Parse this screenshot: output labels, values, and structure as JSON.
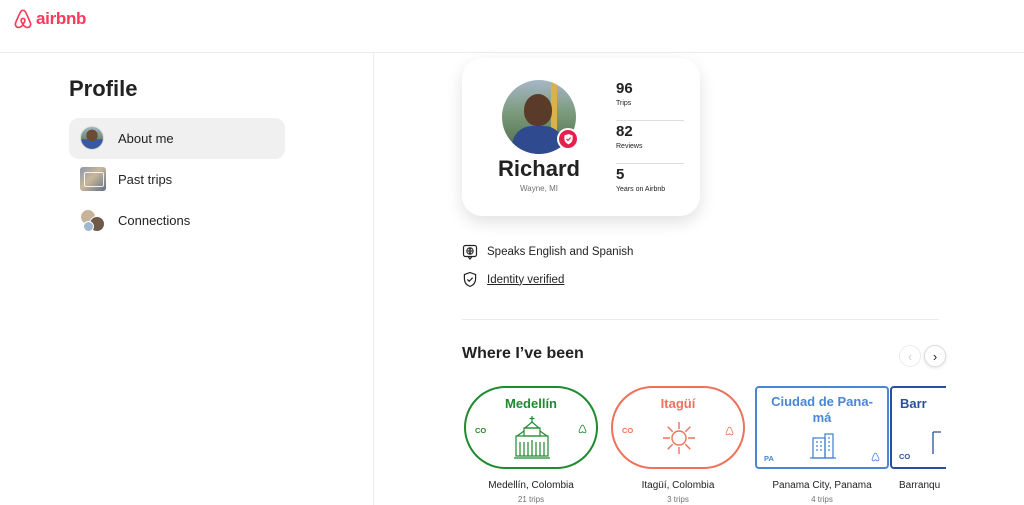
{
  "app": {
    "brand": "airbnb",
    "brand_color": "#ff385c",
    "logo_icon": "airbnb-belo-icon"
  },
  "sidebar": {
    "title": "Profile",
    "items": [
      {
        "label": "About me",
        "icon": "profile-avatar-icon",
        "active": true
      },
      {
        "label": "Past trips",
        "icon": "past-trips-thumbnail-icon",
        "active": false
      },
      {
        "label": "Connections",
        "icon": "connections-avatars-icon",
        "active": false
      }
    ]
  },
  "profile_card": {
    "name": "Richard",
    "location": "Wayne, MI",
    "verified_badge_icon": "shield-check-icon",
    "badge_color": "#e61e4d",
    "stats": [
      {
        "value": "96",
        "label": "Trips"
      },
      {
        "value": "82",
        "label": "Reviews"
      },
      {
        "value": "5",
        "label": "Years on Airbnb"
      }
    ]
  },
  "about": {
    "languages": {
      "icon": "globe-speech-icon",
      "text": "Speaks English and Spanish"
    },
    "identity": {
      "icon": "shield-icon",
      "text": "Identity verified"
    }
  },
  "where_been": {
    "title": "Where I’ve been",
    "prev_icon": "chevron-left-icon",
    "next_icon": "chevron-right-icon",
    "prev_symbol": "‹",
    "next_symbol": "›",
    "places": [
      {
        "stamp_title": "Medellín",
        "country_code": "CO",
        "name": "Medellín, Colombia",
        "trips": "21 trips",
        "color": "#1f8a2e",
        "shape": "oval",
        "art_icon": "cathedral-icon"
      },
      {
        "stamp_title": "Itagüí",
        "country_code": "CO",
        "name": "Itagüí, Colombia",
        "trips": "3 trips",
        "color": "#f0715a",
        "shape": "oval",
        "art_icon": "sun-icon"
      },
      {
        "stamp_title": "Ciudad de Pana-\nmá",
        "country_code": "PA",
        "name": "Panama City, Panama",
        "trips": "4 trips",
        "color": "#4a86d4",
        "shape": "rect",
        "art_icon": "building-icon"
      },
      {
        "stamp_title": "Barr",
        "country_code": "CO",
        "name": "Barranqu",
        "trips": "",
        "color": "#2b4f9e",
        "shape": "rect",
        "art_icon": "monument-icon"
      }
    ]
  }
}
